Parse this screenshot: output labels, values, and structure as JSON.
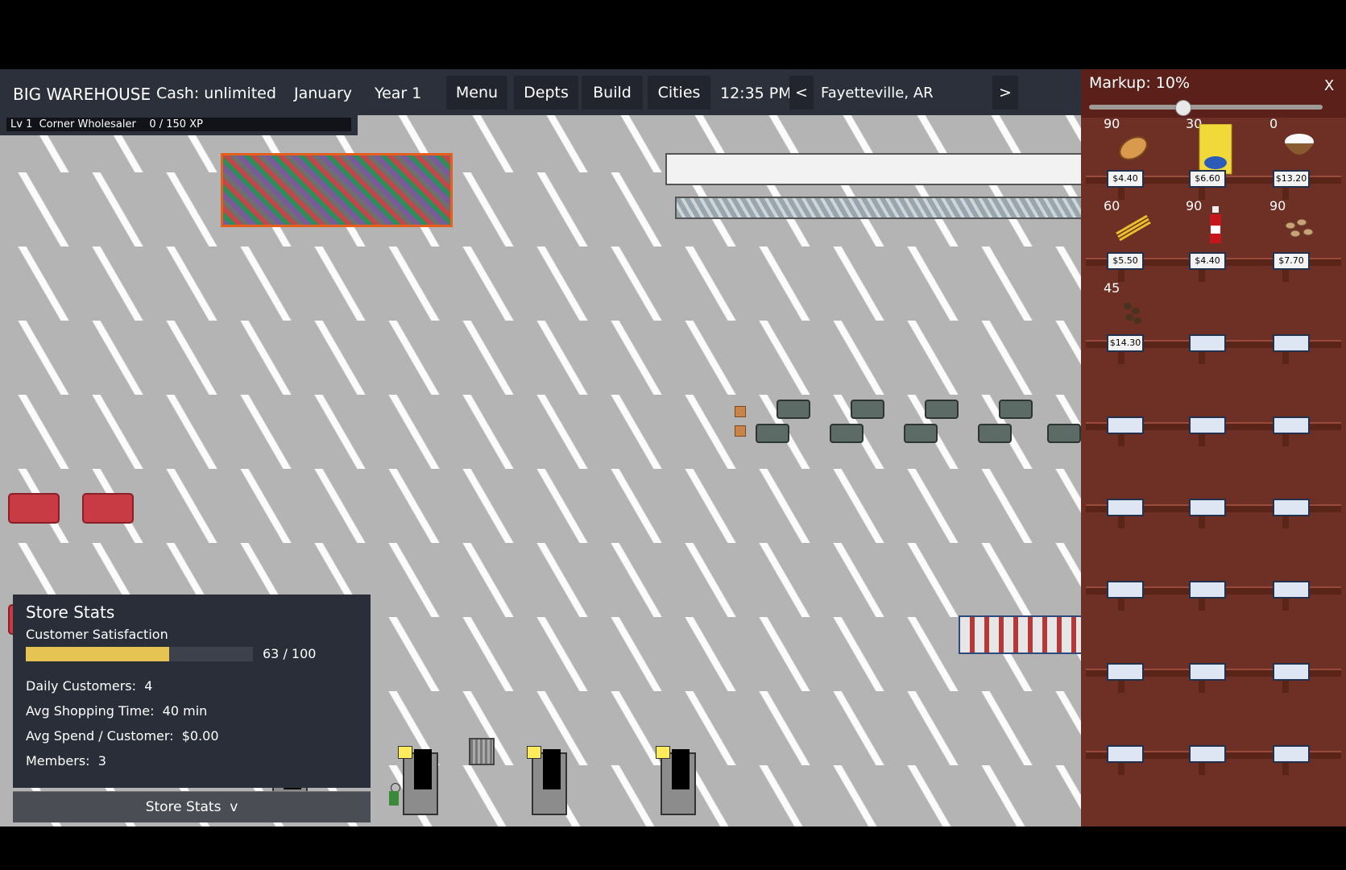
{
  "topbar": {
    "store_name": "BIG WAREHOUSE",
    "cash": "Cash: unlimited",
    "month": "January",
    "year": "Year 1",
    "menu_label": "Menu",
    "depts_label": "Depts",
    "build_label": "Build",
    "cities_label": "Cities",
    "time": "12:35 PM",
    "prev_label": "<",
    "city": "Fayetteville, AR",
    "next_label": ">"
  },
  "level_bar": {
    "text": "Lv 1  Corner Wholesaler    0 / 150 XP",
    "xp_current": 0,
    "xp_max": 150
  },
  "store_stats": {
    "title": "Store Stats",
    "satisfaction_label": "Customer Satisfaction",
    "satisfaction_value": 63,
    "satisfaction_max": 100,
    "satisfaction_text": "63 / 100",
    "daily_customers": "Daily Customers:  4",
    "avg_shopping_time": "Avg Shopping Time:  40 min",
    "avg_spend": "Avg Spend / Customer:  $0.00",
    "members": "Members:  3",
    "toggle_label": "Store Stats  v"
  },
  "panel": {
    "markup_label": "Markup: 10%",
    "markup_fraction": 0.1,
    "close_label": "X",
    "items": [
      {
        "qty": "90",
        "icon": "bread-icon",
        "price": "$4.40"
      },
      {
        "qty": "30",
        "icon": "cereal-box-icon",
        "price": "$6.60"
      },
      {
        "qty": "0",
        "icon": "rice-bowl-icon",
        "price": "$13.20"
      },
      {
        "qty": "60",
        "icon": "pasta-icon",
        "price": "$5.50"
      },
      {
        "qty": "90",
        "icon": "ketchup-bottle-icon",
        "price": "$4.40"
      },
      {
        "qty": "90",
        "icon": "beans-icon",
        "price": "$7.70"
      },
      {
        "qty": "45",
        "icon": "coffee-beans-icon",
        "price": "$14.30"
      }
    ]
  },
  "colors": {
    "topbar_bg": "#2c303a",
    "satisfaction_fill": "#e6c454",
    "panel_bg": "#6e2f25",
    "floor": "#b4b4b4"
  }
}
